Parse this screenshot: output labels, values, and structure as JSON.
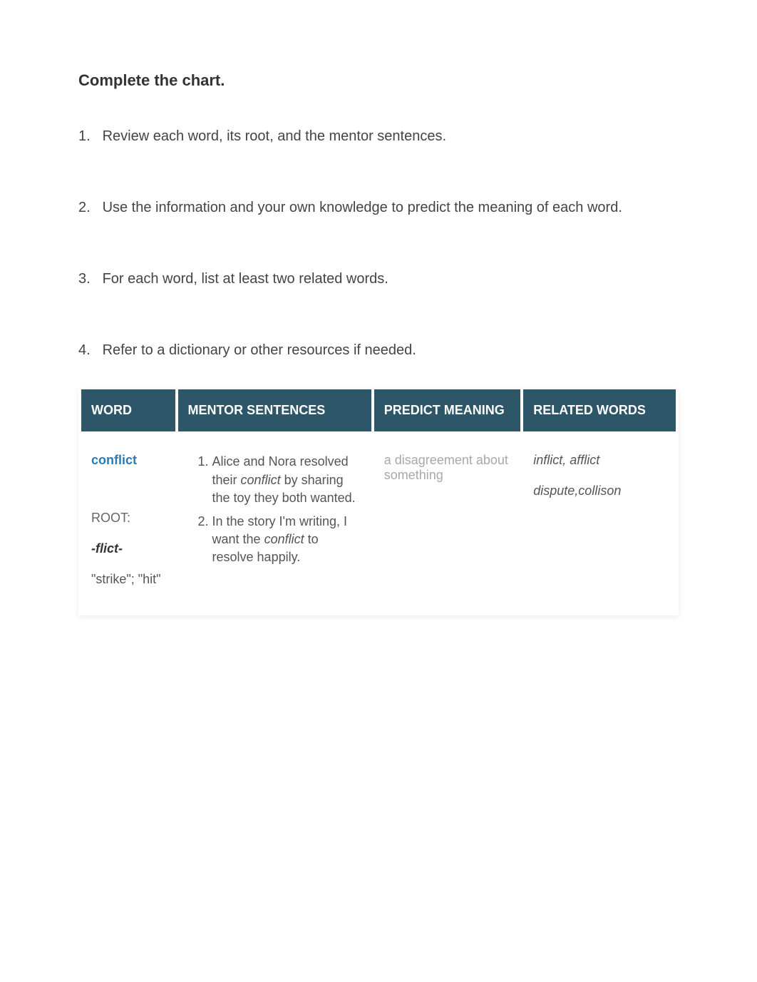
{
  "title": "Complete the chart.",
  "instructions": [
    "Review each word, its root, and the mentor sentences.",
    "Use the information and your own knowledge to predict the meaning of each word.",
    "For each word, list at least two related words.",
    "Refer to a dictionary or other resources if needed."
  ],
  "headers": {
    "word": "WORD",
    "mentor": "MENTOR SENTENCES",
    "predict": "PREDICT MEANING",
    "related": "RELATED WORDS"
  },
  "row": {
    "word": "conflict",
    "root_label": "ROOT:",
    "root": "-flict-",
    "root_meaning": "\"strike\"; \"hit\"",
    "mentor_sentences": {
      "s1_a": "Alice and Nora resolved their ",
      "s1_emph": "conflict",
      "s1_b": " by sharing the toy they both wanted.",
      "s2_a": "In the story I'm writing, I want the ",
      "s2_emph": "conflict",
      "s2_b": " to resolve happily."
    },
    "predict": "a disagreement about something",
    "related_line1": "inflict, afflict",
    "related_line2": "dispute,collison"
  },
  "nums": {
    "n1": "1.",
    "n2": "2.",
    "n3": "3.",
    "n4": "4."
  }
}
